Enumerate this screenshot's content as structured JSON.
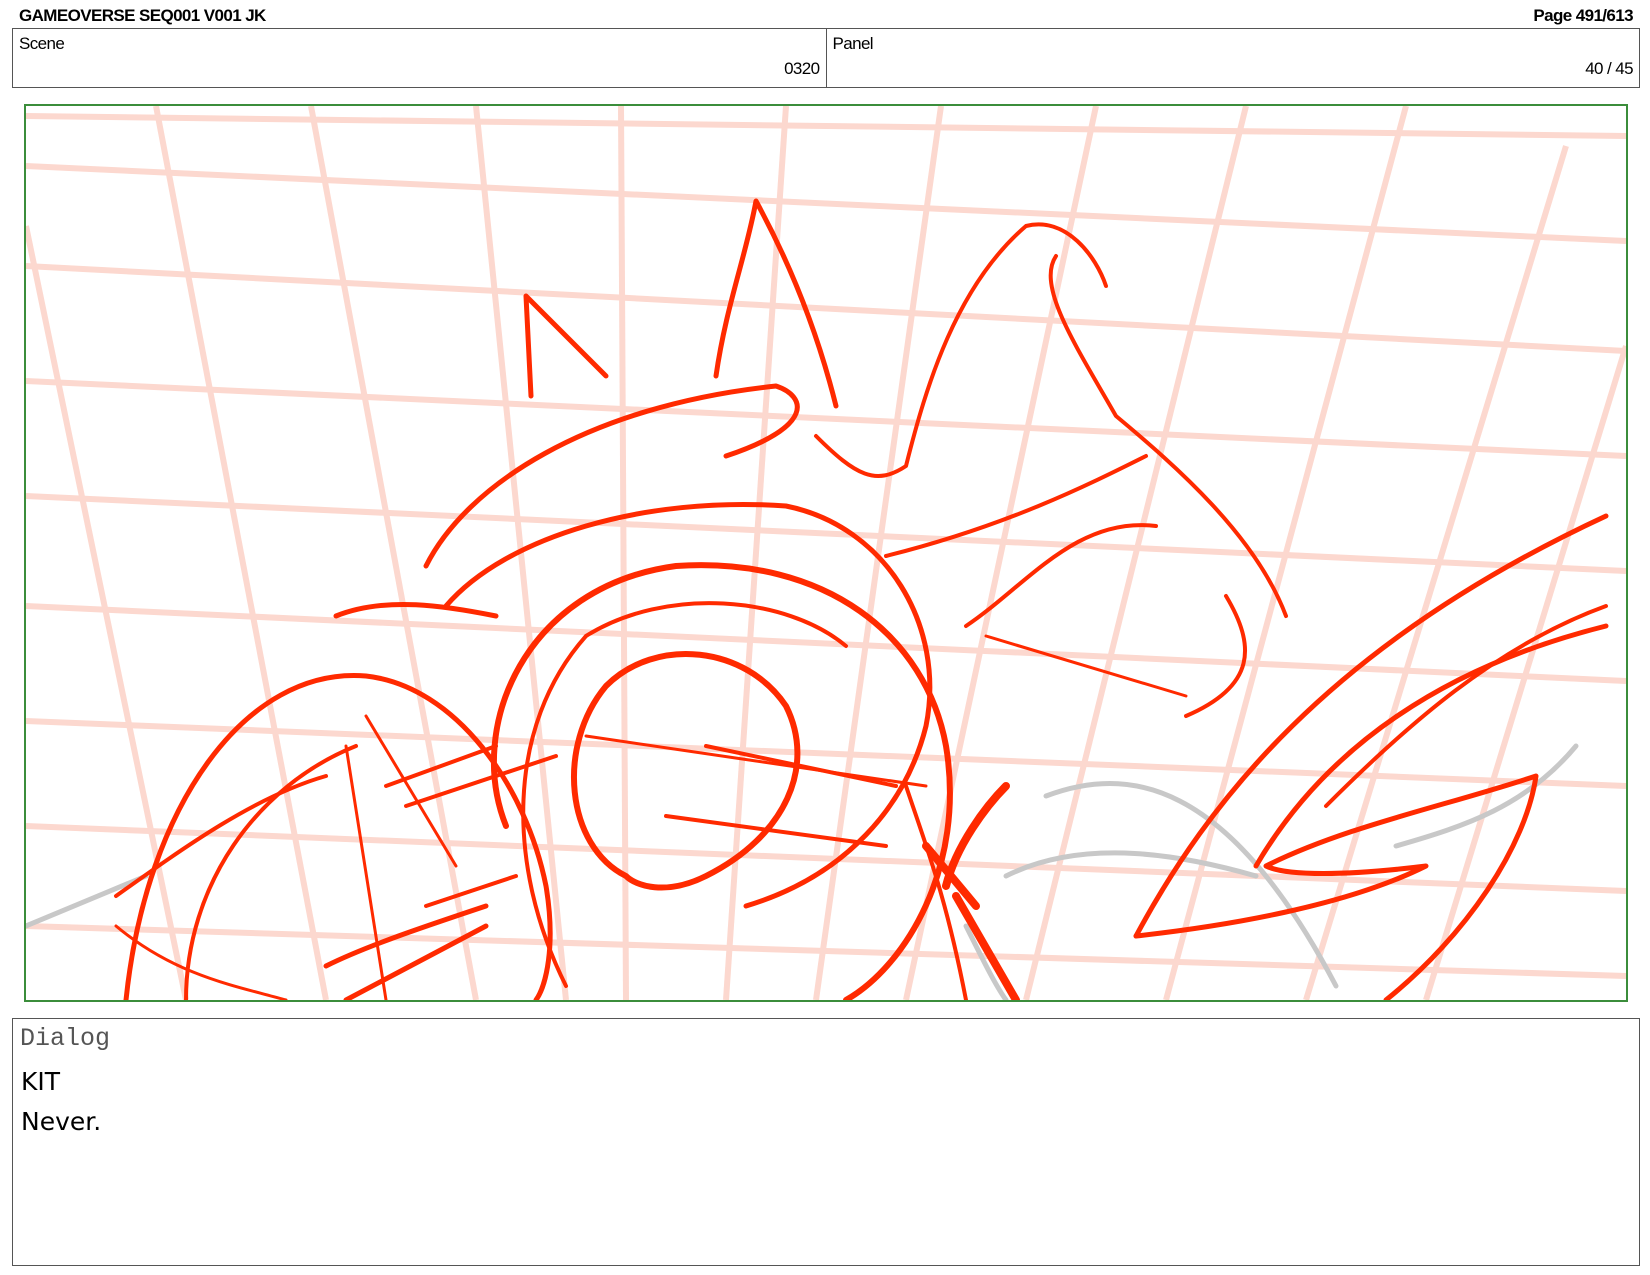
{
  "header": {
    "doc_title": "GAMEOVERSE SEQ001 V001 JK",
    "page_number": "Page 491/613"
  },
  "info": {
    "scene_label": "Scene",
    "scene_value": "0320",
    "panel_label": "Panel",
    "panel_value": "40 / 45"
  },
  "panel": {
    "frame_color": "#3b8d3b",
    "grid_color": "#fcd8cf",
    "sketch_color": "#ff2a00",
    "rough_color": "#c8c8c8"
  },
  "dialog": {
    "heading": "Dialog",
    "speaker": "KIT",
    "line": "Never."
  }
}
